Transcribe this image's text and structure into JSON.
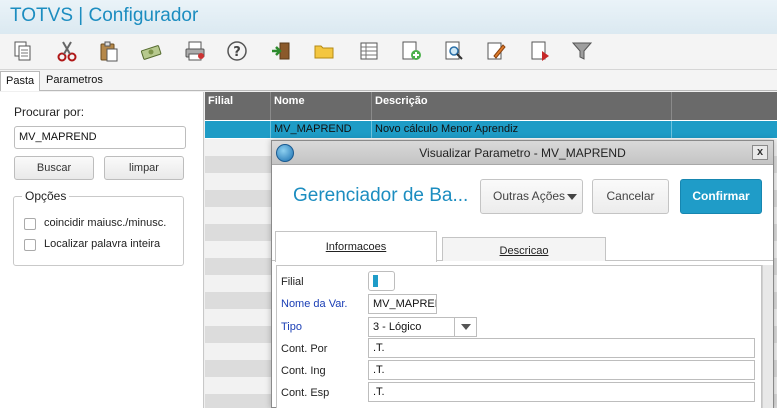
{
  "app": {
    "title": "TOTVS | Configurador"
  },
  "toolbar": {
    "icons": [
      "copy-icon",
      "cut-icon",
      "paste-icon",
      "money-icon",
      "print-icon",
      "help-icon",
      "exit-icon",
      "folder-icon",
      "grid-icon",
      "new-icon",
      "search-doc-icon",
      "edit-icon",
      "delete-icon",
      "filter-icon"
    ]
  },
  "tabs": {
    "pasta": "Pasta",
    "parametros": "Parametros"
  },
  "search": {
    "label": "Procurar por:",
    "value": "MV_MAPREND",
    "buscar": "Buscar",
    "limpar": "limpar",
    "options_title": "Opções",
    "opt1": "coincidir maiusc./minusc.",
    "opt2": "Localizar palavra inteira"
  },
  "grid": {
    "headers": {
      "filial": "Filial",
      "nome": "Nome",
      "descricao": "Descrição"
    },
    "selected_row": {
      "filial": "",
      "nome": "MV_MAPREND",
      "descricao": "Novo cálculo Menor Aprendiz"
    }
  },
  "modal": {
    "title": "Visualizar Parametro - MV_MAPREND",
    "close": "x",
    "heading": "Gerenciador de Ba...",
    "outras_acoes": "Outras Ações",
    "cancelar": "Cancelar",
    "confirmar": "Confirmar",
    "tab_info": "Informacoes",
    "tab_desc": "Descricao",
    "fields": {
      "filial_label": "Filial",
      "filial_value": "",
      "nome_label": "Nome da Var.",
      "nome_value": "MV_MAPREND",
      "tipo_label": "Tipo",
      "tipo_value": "3 - Lógico",
      "cont_por_label": "Cont. Por",
      "cont_por_value": ".T.",
      "cont_ing_label": "Cont. Ing",
      "cont_ing_value": ".T.",
      "cont_esp_label": "Cont. Esp",
      "cont_esp_value": ".T."
    }
  },
  "colors": {
    "accent": "#1c8dc0",
    "selected_row": "#1e9cc6",
    "primary_button": "#1f9cc8"
  }
}
